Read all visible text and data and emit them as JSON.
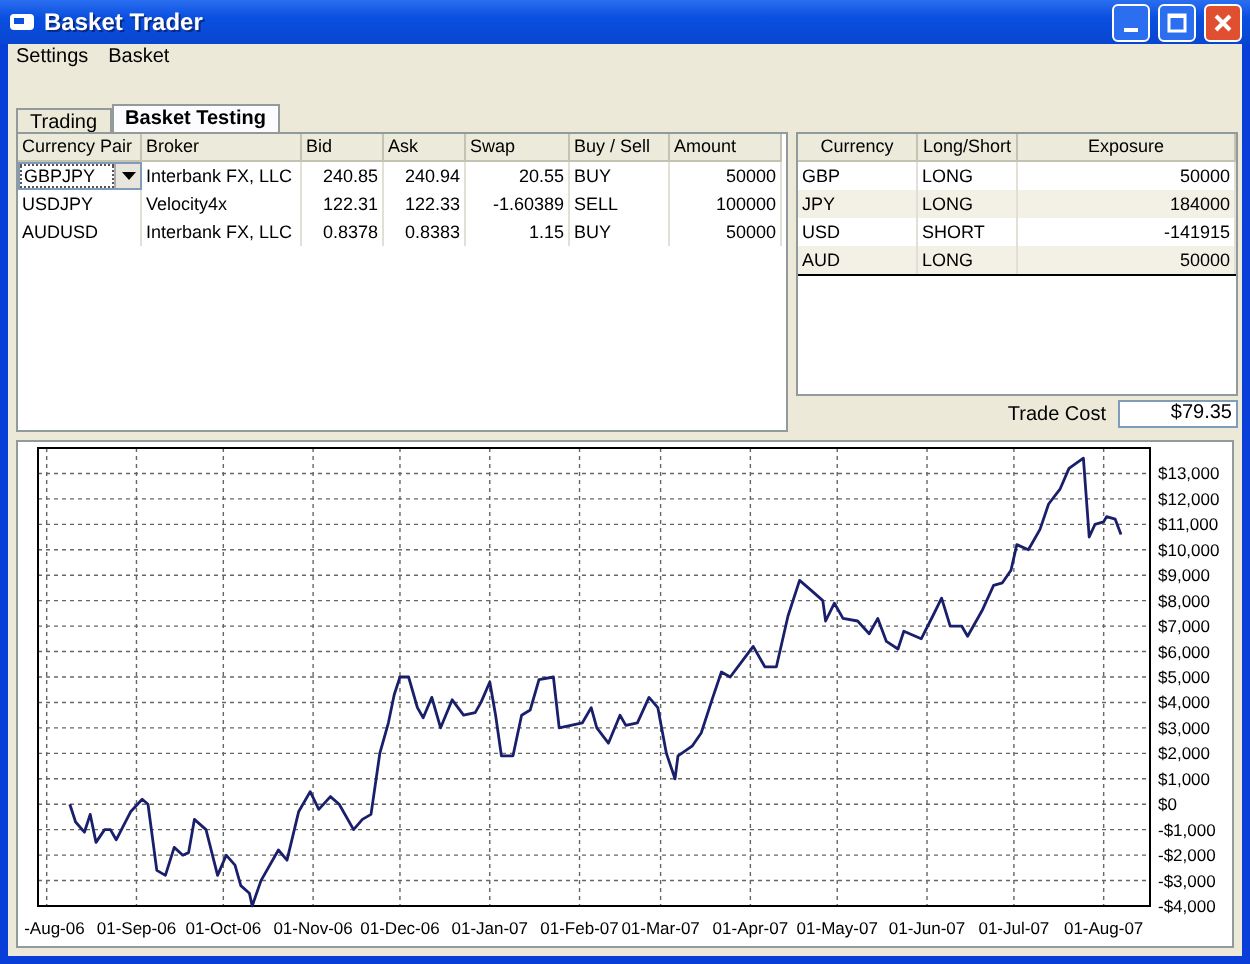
{
  "window": {
    "title": "Basket Trader"
  },
  "menu": [
    {
      "label": "Settings"
    },
    {
      "label": "Basket"
    }
  ],
  "tabs": [
    {
      "label": "Trading",
      "selected": false
    },
    {
      "label": "Basket Testing",
      "selected": true
    }
  ],
  "trades": {
    "columns": [
      {
        "label": "Currency Pair",
        "kind": "text"
      },
      {
        "label": "Broker",
        "kind": "text"
      },
      {
        "label": "Bid",
        "kind": "number"
      },
      {
        "label": "Ask",
        "kind": "number"
      },
      {
        "label": "Swap",
        "kind": "number"
      },
      {
        "label": "Buy / Sell",
        "kind": "text"
      },
      {
        "label": "Amount",
        "kind": "number"
      }
    ],
    "rows": [
      {
        "editing": true,
        "cells": [
          "GBPJPY",
          "Interbank FX, LLC",
          "240.85",
          "240.94",
          "20.55",
          "BUY",
          "50000"
        ]
      },
      {
        "editing": false,
        "cells": [
          "USDJPY",
          "Velocity4x",
          "122.31",
          "122.33",
          "-1.60389",
          "SELL",
          "100000"
        ]
      },
      {
        "editing": false,
        "cells": [
          "AUDUSD",
          "Interbank FX, LLC",
          "0.8378",
          "0.8383",
          "1.15",
          "BUY",
          "50000"
        ]
      }
    ]
  },
  "exposure": {
    "columns": [
      {
        "label": "Currency",
        "kind": "text"
      },
      {
        "label": "Long/Short",
        "kind": "text"
      },
      {
        "label": "Exposure",
        "kind": "number"
      }
    ],
    "rows": [
      [
        "GBP",
        "LONG",
        "50000"
      ],
      [
        "JPY",
        "LONG",
        "184000"
      ],
      [
        "USD",
        "SHORT",
        "-141915"
      ],
      [
        "AUD",
        "LONG",
        "50000"
      ]
    ]
  },
  "trade_cost": {
    "label": "Trade Cost",
    "value": "$79.35"
  },
  "chart": {
    "chart_data": {
      "type": "line",
      "grid": true,
      "xlim": [
        "2006-07-29",
        "2007-08-17"
      ],
      "ylim": [
        -4000,
        14000
      ],
      "xticks": [
        {
          "value": "2006-08-01",
          "label": "-Aug-06"
        },
        {
          "value": "2006-09-01",
          "label": "01-Sep-06"
        },
        {
          "value": "2006-10-01",
          "label": "01-Oct-06"
        },
        {
          "value": "2006-11-01",
          "label": "01-Nov-06"
        },
        {
          "value": "2006-12-01",
          "label": "01-Dec-06"
        },
        {
          "value": "2007-01-01",
          "label": "01-Jan-07"
        },
        {
          "value": "2007-02-01",
          "label": "01-Feb-07"
        },
        {
          "value": "2007-03-01",
          "label": "01-Mar-07"
        },
        {
          "value": "2007-04-01",
          "label": "01-Apr-07"
        },
        {
          "value": "2007-05-01",
          "label": "01-May-07"
        },
        {
          "value": "2007-06-01",
          "label": "01-Jun-07"
        },
        {
          "value": "2007-07-01",
          "label": "01-Jul-07"
        },
        {
          "value": "2007-08-01",
          "label": "01-Aug-07"
        }
      ],
      "yticks": [
        {
          "value": -4000,
          "label": "-$4,000"
        },
        {
          "value": -3000,
          "label": "-$3,000"
        },
        {
          "value": -2000,
          "label": "-$2,000"
        },
        {
          "value": -1000,
          "label": "-$1,000"
        },
        {
          "value": 0,
          "label": "$0"
        },
        {
          "value": 1000,
          "label": "$1,000"
        },
        {
          "value": 2000,
          "label": "$2,000"
        },
        {
          "value": 3000,
          "label": "$3,000"
        },
        {
          "value": 4000,
          "label": "$4,000"
        },
        {
          "value": 5000,
          "label": "$5,000"
        },
        {
          "value": 6000,
          "label": "$6,000"
        },
        {
          "value": 7000,
          "label": "$7,000"
        },
        {
          "value": 8000,
          "label": "$8,000"
        },
        {
          "value": 9000,
          "label": "$9,000"
        },
        {
          "value": 10000,
          "label": "$10,000"
        },
        {
          "value": 11000,
          "label": "$11,000"
        },
        {
          "value": 12000,
          "label": "$12,000"
        },
        {
          "value": 13000,
          "label": "$13,000"
        }
      ],
      "x": [
        "2006-08-09",
        "2006-08-11",
        "2006-08-14",
        "2006-08-16",
        "2006-08-18",
        "2006-08-21",
        "2006-08-23",
        "2006-08-25",
        "2006-08-30",
        "2006-09-03",
        "2006-09-05",
        "2006-09-08",
        "2006-09-11",
        "2006-09-14",
        "2006-09-17",
        "2006-09-19",
        "2006-09-21",
        "2006-09-25",
        "2006-09-29",
        "2006-10-02",
        "2006-10-05",
        "2006-10-07",
        "2006-10-10",
        "2006-10-11",
        "2006-10-14",
        "2006-10-20",
        "2006-10-23",
        "2006-10-27",
        "2006-10-31",
        "2006-11-03",
        "2006-11-07",
        "2006-11-10",
        "2006-11-15",
        "2006-11-18",
        "2006-11-21",
        "2006-11-24",
        "2006-11-27",
        "2006-11-29",
        "2006-12-01",
        "2006-12-04",
        "2006-12-07",
        "2006-12-09",
        "2006-12-12",
        "2006-12-15",
        "2006-12-19",
        "2006-12-23",
        "2006-12-27",
        "2006-12-29",
        "2007-01-01",
        "2007-01-03",
        "2007-01-05",
        "2007-01-09",
        "2007-01-12",
        "2007-01-15",
        "2007-01-18",
        "2007-01-23",
        "2007-01-25",
        "2007-01-29",
        "2007-02-02",
        "2007-02-05",
        "2007-02-07",
        "2007-02-11",
        "2007-02-15",
        "2007-02-17",
        "2007-02-21",
        "2007-02-25",
        "2007-02-28",
        "2007-03-03",
        "2007-03-06",
        "2007-03-07",
        "2007-03-12",
        "2007-03-15",
        "2007-03-19",
        "2007-03-22",
        "2007-03-25",
        "2007-03-29",
        "2007-04-02",
        "2007-04-06",
        "2007-04-10",
        "2007-04-14",
        "2007-04-18",
        "2007-04-22",
        "2007-04-26",
        "2007-04-27",
        "2007-04-30",
        "2007-05-03",
        "2007-05-08",
        "2007-05-12",
        "2007-05-15",
        "2007-05-18",
        "2007-05-22",
        "2007-05-24",
        "2007-05-30",
        "2007-06-03",
        "2007-06-06",
        "2007-06-09",
        "2007-06-13",
        "2007-06-15",
        "2007-06-20",
        "2007-06-24",
        "2007-06-27",
        "2007-06-30",
        "2007-07-02",
        "2007-07-06",
        "2007-07-10",
        "2007-07-13",
        "2007-07-17",
        "2007-07-20",
        "2007-07-25",
        "2007-07-27",
        "2007-07-29",
        "2007-08-01",
        "2007-08-02",
        "2007-08-05",
        "2007-08-07"
      ],
      "series": [
        {
          "color": "#1a1f6b",
          "values": [
            0,
            -700,
            -1100,
            -400,
            -1500,
            -1000,
            -1000,
            -1400,
            -300,
            200,
            0,
            -2600,
            -2800,
            -1700,
            -2000,
            -1900,
            -600,
            -1000,
            -2800,
            -2000,
            -2400,
            -3200,
            -3500,
            -4000,
            -3000,
            -1800,
            -2200,
            -300,
            500,
            -200,
            300,
            0,
            -1000,
            -600,
            -400,
            2000,
            3200,
            4300,
            5000,
            5000,
            3800,
            3400,
            4200,
            3000,
            4100,
            3500,
            3600,
            4000,
            4800,
            3500,
            1900,
            1900,
            3500,
            3700,
            4900,
            5000,
            3000,
            3100,
            3200,
            3800,
            3000,
            2400,
            3500,
            3100,
            3200,
            4200,
            3800,
            2000,
            1000,
            1900,
            2300,
            2800,
            4200,
            5200,
            5000,
            5600,
            6200,
            5400,
            5400,
            7400,
            8800,
            8400,
            8000,
            7200,
            7900,
            7300,
            7200,
            6700,
            7300,
            6400,
            6100,
            6800,
            6500,
            7400,
            8100,
            7000,
            7000,
            6600,
            7600,
            8600,
            8700,
            9200,
            10200,
            10000,
            10800,
            11800,
            12400,
            13200,
            13600,
            10500,
            11000,
            11100,
            11300,
            11200,
            10600
          ]
        }
      ]
    }
  }
}
